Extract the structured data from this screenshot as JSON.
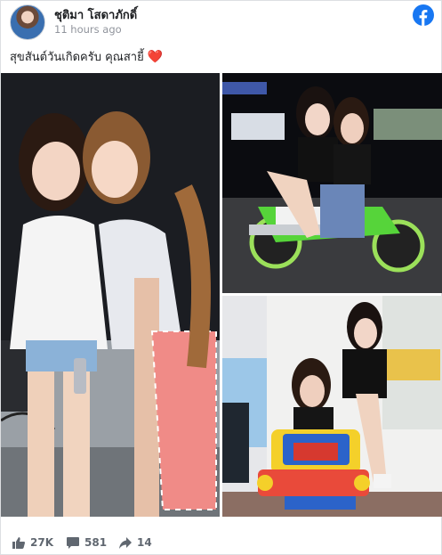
{
  "post": {
    "author": "ชุติมา โสดาภักดิ์",
    "timestamp": "11 hours ago",
    "caption": "สุขสันต์วันเกิดครับ คุณสายี้",
    "caption_emoji": "❤️",
    "brand_icon": "facebook-icon",
    "brand_color": "#1877f2"
  },
  "stats": {
    "likes": "27K",
    "comments": "581",
    "shares": "14"
  },
  "photos": [
    {
      "name": "photo-hug-on-stage"
    },
    {
      "name": "photo-motorbike-night"
    },
    {
      "name": "photo-kiddie-ride-car"
    }
  ]
}
